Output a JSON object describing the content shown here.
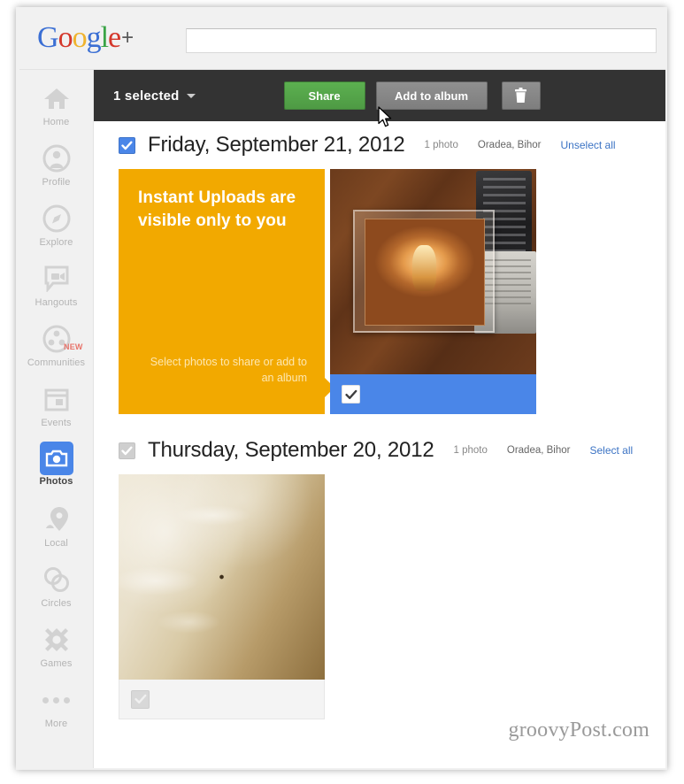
{
  "brand": {
    "logo_g1": "G",
    "logo_o1": "o",
    "logo_o2": "o",
    "logo_g2": "g",
    "logo_l": "l",
    "logo_e": "e",
    "logo_plus": "+"
  },
  "search": {
    "value": "",
    "placeholder": ""
  },
  "sidebar": {
    "items": [
      {
        "label": "Home",
        "icon": "home-icon",
        "active": false
      },
      {
        "label": "Profile",
        "icon": "profile-icon",
        "active": false
      },
      {
        "label": "Explore",
        "icon": "explore-compass-icon",
        "active": false
      },
      {
        "label": "Hangouts",
        "icon": "hangouts-video-icon",
        "active": false
      },
      {
        "label": "Communities",
        "icon": "communities-icon",
        "active": false,
        "badge": "NEW"
      },
      {
        "label": "Events",
        "icon": "events-calendar-icon",
        "active": false
      },
      {
        "label": "Photos",
        "icon": "photos-camera-icon",
        "active": true
      },
      {
        "label": "Local",
        "icon": "local-pin-icon",
        "active": false
      },
      {
        "label": "Circles",
        "icon": "circles-icon",
        "active": false
      },
      {
        "label": "Games",
        "icon": "games-icon",
        "active": false
      },
      {
        "label": "More",
        "icon": "more-dots-icon",
        "active": false
      }
    ]
  },
  "action_bar": {
    "selected_count_label": "1 selected",
    "share_label": "Share",
    "add_to_album_label": "Add to album",
    "delete_icon": "trash-icon",
    "background_color": "#333333",
    "share_color": "#55a64a",
    "button_color": "#8a8a8a"
  },
  "promo": {
    "title": "Instant Uploads are visible only to you",
    "subtitle": "Select photos to share or add to an album",
    "background_color": "#f2a900"
  },
  "sections": [
    {
      "date": "Friday, September 21, 2012",
      "photo_count": "1 photo",
      "location": "Oradea, Bihor",
      "select_link": "Unselect all",
      "checkbox_state": "checked",
      "photos": [
        {
          "name": "cd-jewel-case-photo",
          "selected": true
        }
      ]
    },
    {
      "date": "Thursday, September 20, 2012",
      "photo_count": "1 photo",
      "location": "Oradea, Bihor",
      "select_link": "Select all",
      "checkbox_state": "unchecked",
      "photos": [
        {
          "name": "foam-texture-photo",
          "selected": false
        }
      ]
    }
  ],
  "watermark": {
    "text": "groovyPost.com"
  },
  "colors": {
    "accent_blue": "#4a86e8",
    "link_blue": "#3b73c4",
    "page_bg": "#f1f1f1"
  }
}
